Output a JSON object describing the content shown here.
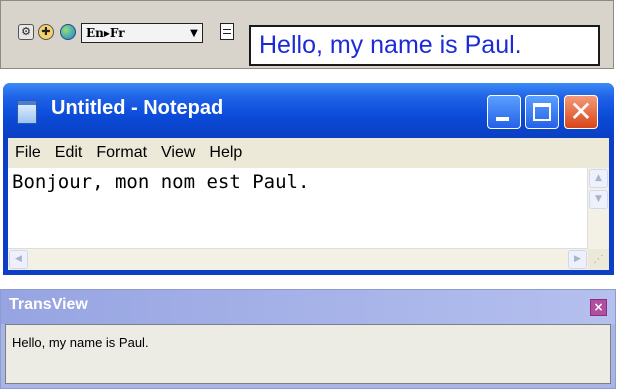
{
  "toolbar": {
    "icons": [
      "tool-icon",
      "crosshair-icon",
      "globe-icon",
      "document-icon"
    ],
    "language_pair": "En▸Fr",
    "dropdown_arrow": "▼",
    "output_text": "Hello, my name is Paul.",
    "output_color": "#1c2bd6"
  },
  "notepad": {
    "title": "Untitled - Notepad",
    "menu": [
      "File",
      "Edit",
      "Format",
      "View",
      "Help"
    ],
    "content": "Bonjour, mon nom est Paul.",
    "close_glyph": "✕"
  },
  "transview": {
    "title": "TransView",
    "close_glyph": "×",
    "text": "Hello, my name is Paul."
  },
  "colors": {
    "titlebar": "#0b4bd9",
    "chrome": "#ece9d8",
    "transview_title": "#a9b5e6"
  }
}
